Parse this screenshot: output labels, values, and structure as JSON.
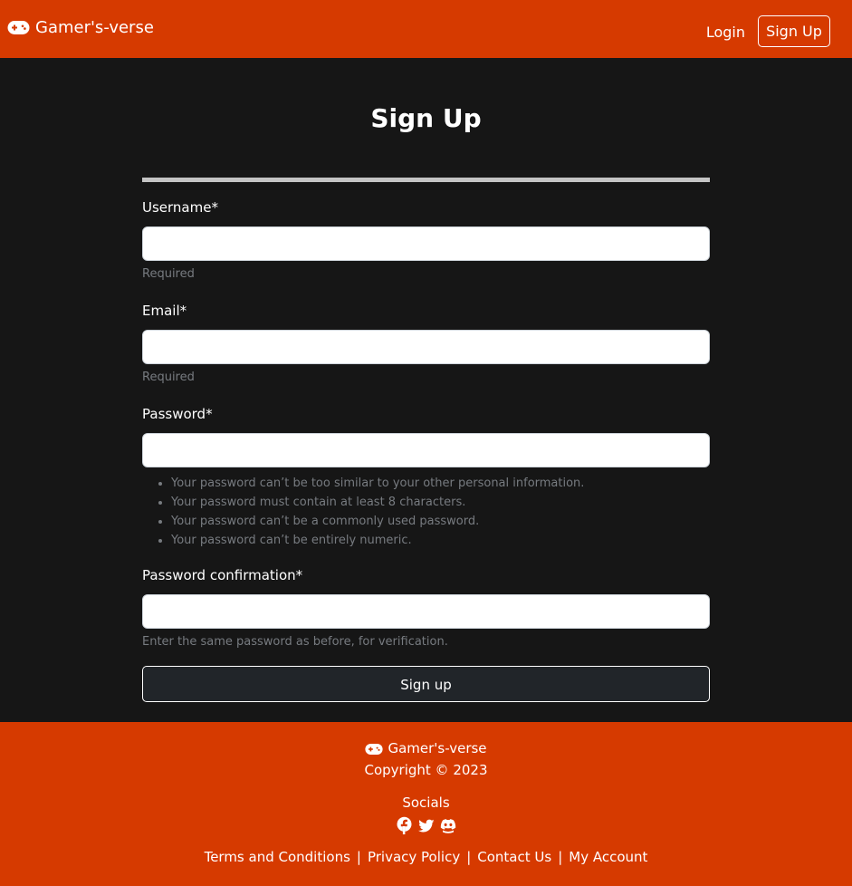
{
  "nav": {
    "brand": "Gamer's-verse",
    "brand_icon": "gamepad-icon",
    "login_label": "Login",
    "signup_label": "Sign Up"
  },
  "main": {
    "title": "Sign Up",
    "fields": {
      "username": {
        "label": "Username*",
        "value": "",
        "placeholder": "",
        "help": "Required"
      },
      "email": {
        "label": "Email*",
        "value": "",
        "placeholder": "",
        "help": "Required"
      },
      "password": {
        "label": "Password*",
        "value": "",
        "placeholder": "",
        "help_items": [
          "Your password can’t be too similar to your other personal information.",
          "Your password must contain at least 8 characters.",
          "Your password can’t be a commonly used password.",
          "Your password can’t be entirely numeric."
        ]
      },
      "password_confirmation": {
        "label": "Password confirmation*",
        "value": "",
        "placeholder": "",
        "help": "Enter the same password as before, for verification."
      }
    },
    "submit_label": "Sign up"
  },
  "footer": {
    "brand": "Gamer's-verse",
    "brand_icon": "gamepad-icon",
    "copyright": "Copyright © 2023",
    "socials_label": "Socials",
    "social_icons": [
      "facebook-icon",
      "twitter-icon",
      "discord-icon"
    ],
    "links": [
      "Terms and Conditions",
      "Privacy Policy",
      "Contact Us",
      "My Account"
    ],
    "separator": "|"
  },
  "colors": {
    "brand_orange": "#d63a00",
    "page_background": "#161616",
    "button_dark": "#212529",
    "help_text": "#777b80",
    "divider": "#c4c4c4"
  }
}
